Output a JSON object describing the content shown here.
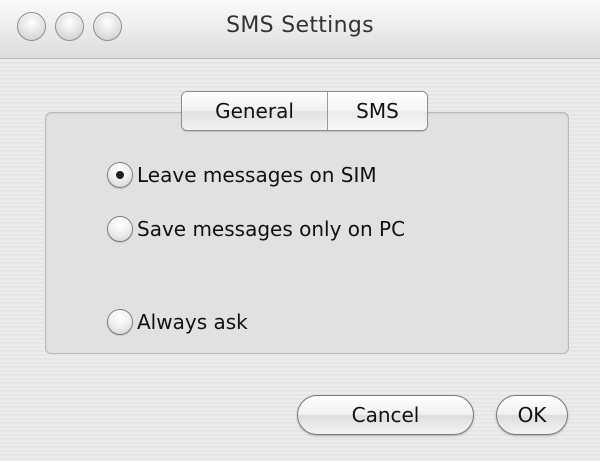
{
  "window": {
    "title": "SMS Settings"
  },
  "tabs": [
    {
      "label": "General"
    },
    {
      "label": "SMS"
    }
  ],
  "options": [
    {
      "label": "Leave messages on SIM",
      "selected": true
    },
    {
      "label": "Save messages only on PC",
      "selected": false
    },
    {
      "label": "Always ask",
      "selected": false
    }
  ],
  "buttons": {
    "cancel_label": "Cancel",
    "ok_label": "OK"
  },
  "icons": {
    "close": "close-icon",
    "minimize": "minimize-icon",
    "zoom": "zoom-icon"
  }
}
